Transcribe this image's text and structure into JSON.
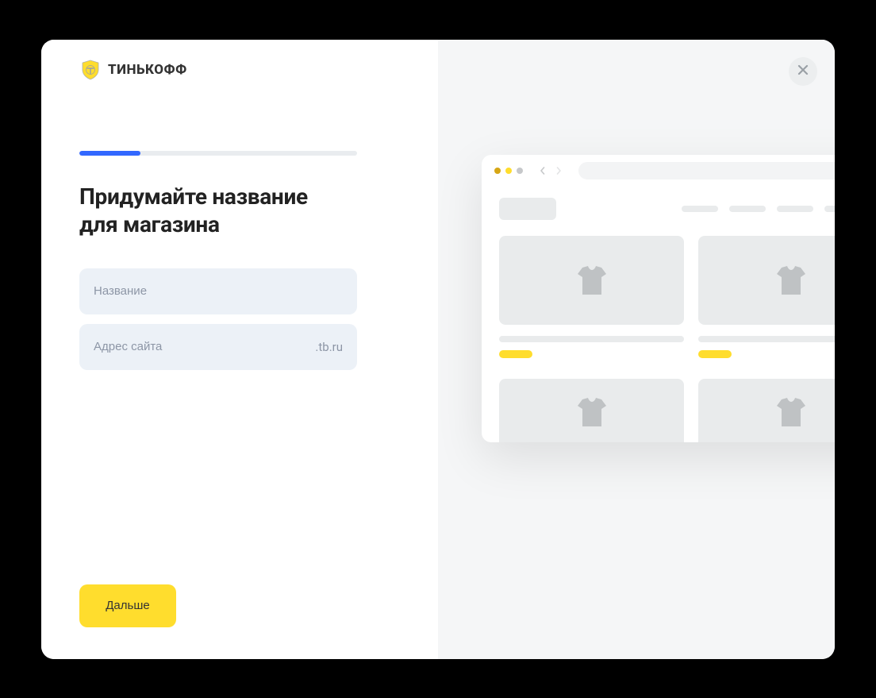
{
  "brand": {
    "name": "ТИНЬКОФФ"
  },
  "progress": {
    "percent": 22
  },
  "heading": "Придумайте название\nдля магазина",
  "form": {
    "name_placeholder": "Название",
    "site_placeholder": "Адрес сайта",
    "domain_suffix": ".tb.ru"
  },
  "actions": {
    "next": "Дальше"
  },
  "colors": {
    "accent_yellow": "#ffdd2d",
    "progress_blue": "#3268ff",
    "input_bg": "#ecf1f7",
    "preview_bg": "#f5f6f7"
  },
  "preview": {
    "type": "storefront-wireframe",
    "traffic_lights": [
      "amber",
      "yellow",
      "gray"
    ],
    "nav_items_count": 5,
    "product_placeholder": "tshirt"
  }
}
